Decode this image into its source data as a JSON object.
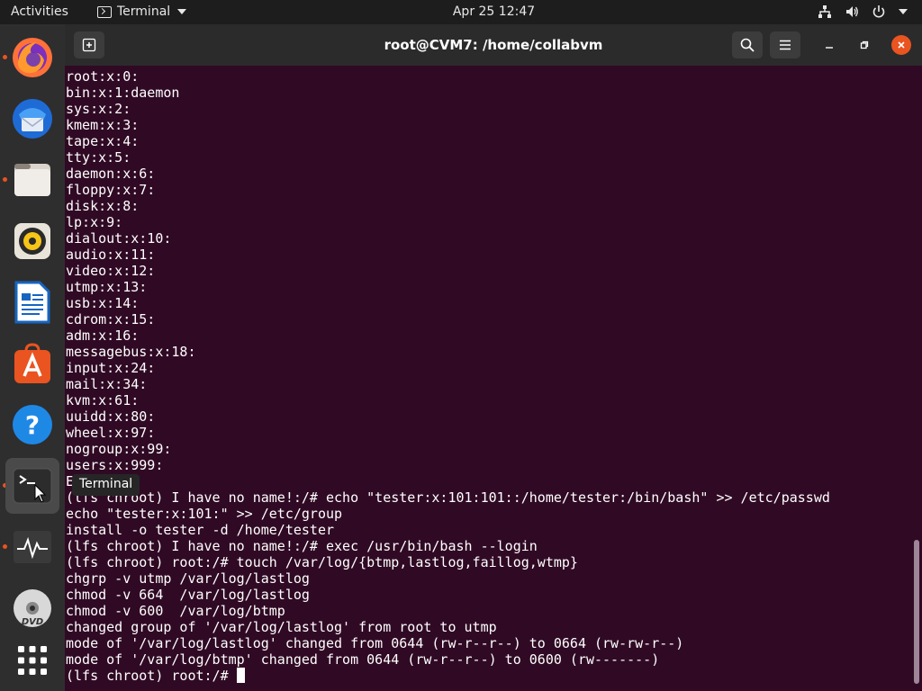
{
  "topbar": {
    "activities": "Activities",
    "app_name": "Terminal",
    "clock": "Apr 25  12:47"
  },
  "dock": {
    "tooltip": "Terminal",
    "items": [
      "firefox",
      "thunderbird",
      "files",
      "rhythmbox",
      "libreoffice-writer",
      "ubuntu-software",
      "help",
      "terminal",
      "system-monitor",
      "dvd",
      "show-applications"
    ]
  },
  "window": {
    "title": "root@CVM7: /home/collabvm"
  },
  "terminal": {
    "lines": [
      "root:x:0:",
      "bin:x:1:daemon",
      "sys:x:2:",
      "kmem:x:3:",
      "tape:x:4:",
      "tty:x:5:",
      "daemon:x:6:",
      "floppy:x:7:",
      "disk:x:8:",
      "lp:x:9:",
      "dialout:x:10:",
      "audio:x:11:",
      "video:x:12:",
      "utmp:x:13:",
      "usb:x:14:",
      "cdrom:x:15:",
      "adm:x:16:",
      "messagebus:x:18:",
      "input:x:24:",
      "mail:x:34:",
      "kvm:x:61:",
      "uuidd:x:80:",
      "wheel:x:97:",
      "nogroup:x:99:",
      "users:x:999:",
      "E",
      "(lfs chroot) I have no name!:/# echo \"tester:x:101:101::/home/tester:/bin/bash\" >> /etc/passwd",
      "echo \"tester:x:101:\" >> /etc/group",
      "install -o tester -d /home/tester",
      "(lfs chroot) I have no name!:/# exec /usr/bin/bash --login",
      "(lfs chroot) root:/# touch /var/log/{btmp,lastlog,faillog,wtmp}",
      "chgrp -v utmp /var/log/lastlog",
      "chmod -v 664  /var/log/lastlog",
      "chmod -v 600  /var/log/btmp",
      "changed group of '/var/log/lastlog' from root to utmp",
      "mode of '/var/log/lastlog' changed from 0644 (rw-r--r--) to 0664 (rw-rw-r--)",
      "mode of '/var/log/btmp' changed from 0644 (rw-r--r--) to 0600 (rw-------)"
    ],
    "prompt": "(lfs chroot) root:/# "
  },
  "colors": {
    "terminal_bg": "#300a24",
    "topbar_bg": "#1d1d1d",
    "dock_bg": "#2e2e2e",
    "close_button": "#e95420"
  }
}
